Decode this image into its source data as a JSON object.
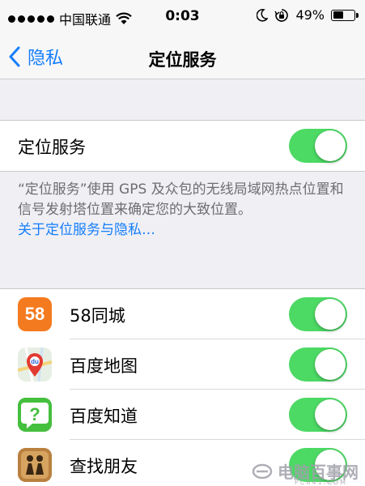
{
  "status_bar": {
    "carrier": "中国联通",
    "time": "0:03",
    "battery_percent": "49%",
    "battery_level": 0.49,
    "signal_dots": 5
  },
  "nav": {
    "back_label": "隐私",
    "title": "定位服务"
  },
  "location_services": {
    "label": "定位服务",
    "enabled": true,
    "description": "“定位服务”使用 GPS 及众包的无线局域网热点位置和信号发射塔位置来确定您的大致位置。",
    "link": "关于定位服务与隐私…"
  },
  "apps": [
    {
      "name": "58同城",
      "icon": "app-58-icon",
      "icon_text": "58",
      "enabled": true
    },
    {
      "name": "百度地图",
      "icon": "baidu-map-icon",
      "icon_text": "du",
      "enabled": true
    },
    {
      "name": "百度知道",
      "icon": "baidu-zhidao-icon",
      "enabled": true
    },
    {
      "name": "查找朋友",
      "icon": "find-friends-icon",
      "enabled": true
    }
  ],
  "watermark": {
    "text": "电脑百事网",
    "sub": "PC841.COM"
  },
  "colors": {
    "accent": "#157efb",
    "toggle_on": "#4cd964",
    "background": "#efeff4"
  }
}
